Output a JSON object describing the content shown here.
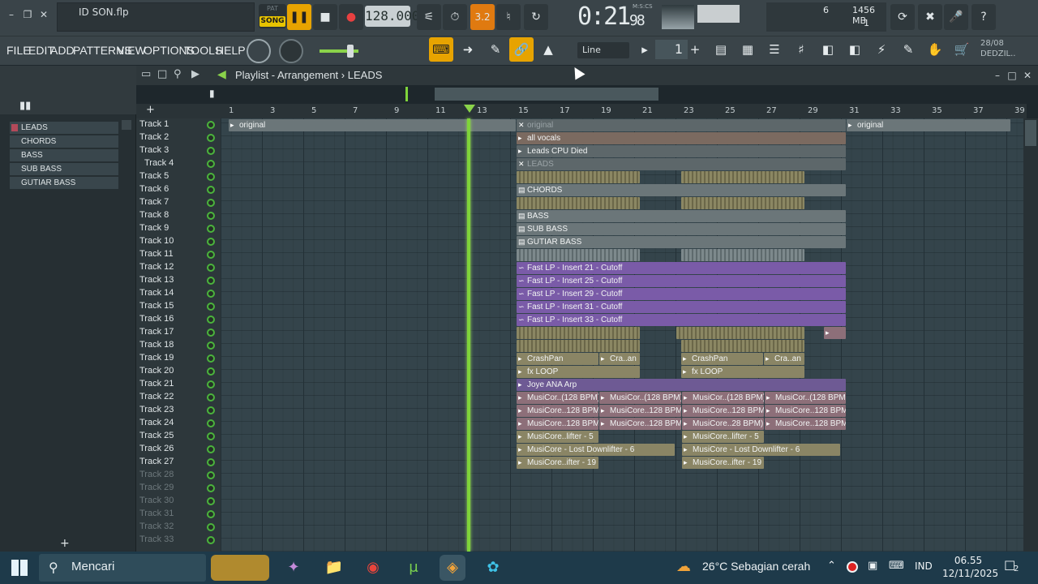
{
  "window": {
    "filename": "ID SON.flp",
    "controls": [
      "minimize",
      "restore",
      "close"
    ]
  },
  "transport": {
    "pat_label": "PAT",
    "song_label": "SONG",
    "tempo": "128.000",
    "time_main": "0:21",
    "time_frac": "98",
    "time_unit": "M:S:CS",
    "pattern_time_badge": "3.2",
    "cpu_count": "6",
    "memory": "1456 MB",
    "polyphony": "1"
  },
  "menu": {
    "items": [
      "FILE",
      "EDIT",
      "ADD",
      "PATTERNS",
      "VIEW",
      "OPTIONS",
      "TOOLS",
      "HELP"
    ]
  },
  "toolbar": {
    "snap_value": "Line",
    "pattern_number": "1",
    "date_top": "28/08",
    "date_bottom": "DEDZIL.."
  },
  "browser": {
    "items": [
      "LEADS",
      "CHORDS",
      "BASS",
      "SUB BASS",
      "GUTIAR BASS"
    ],
    "accent": "#b34a5a"
  },
  "playlist": {
    "title": "Playlist - Arrangement",
    "pattern": "LEADS",
    "bars": [
      "1",
      "3",
      "5",
      "7",
      "9",
      "11",
      "13",
      "15",
      "17",
      "19",
      "21",
      "23",
      "25",
      "27",
      "29",
      "31",
      "33",
      "35",
      "37",
      "39"
    ],
    "tracks": [
      "Track 1",
      "Track 2",
      "Track 3",
      "Track 4",
      "Track 5",
      "Track 6",
      "Track 7",
      "Track 8",
      "Track 9",
      "Track 10",
      "Track 11",
      "Track 12",
      "Track 13",
      "Track 14",
      "Track 15",
      "Track 16",
      "Track 17",
      "Track 18",
      "Track 19",
      "Track 20",
      "Track 21",
      "Track 22",
      "Track 23",
      "Track 24",
      "Track 25",
      "Track 26",
      "Track 27",
      "Track 28",
      "Track 29",
      "Track 30",
      "Track 31",
      "Track 32",
      "Track 33"
    ],
    "playhead_color": "#7fd43a",
    "clips": {
      "original_a": "original",
      "original_b": "original",
      "original_c": "original",
      "all_vocals": "all vocals",
      "leads_cpu": "Leads CPU Died",
      "leads": "LEADS",
      "chords": "CHORDS",
      "bass": "BASS",
      "sub_bass": "SUB BASS",
      "gutiar_bass": "GUTIAR BASS",
      "auto1": "Fast LP - Insert 21 - Cutoff",
      "auto2": "Fast LP - Insert 25 - Cutoff",
      "auto3": "Fast LP - Insert 29 - Cutoff",
      "auto4": "Fast LP - Insert 31 - Cutoff",
      "auto5": "Fast LP - Insert 33 - Cutoff",
      "crashpan_a": "CrashPan",
      "cra_an_a": "Cra..an",
      "crashpan_b": "CrashPan",
      "cra_an_b": "Cra..an",
      "fxloop_a": "fx LOOP",
      "fxloop_b": "fx LOOP",
      "joye": "Joye ANA Arp",
      "mc22_1": "MusiCor..(128 BPM)",
      "mc22_2": "MusiCor..(128 BPM)",
      "mc22_3": "MusiCor..(128 BPM)",
      "mc22_4": "MusiCor..(128 BPM)",
      "mc23_1": "MusiCore..128 BPM)",
      "mc23_2": "MusiCore..128 BPM)",
      "mc23_3": "MusiCore..128 BPM)",
      "mc23_4": "MusiCore..128 BPM)",
      "mc24_1": "MusiCore..128 BPM)",
      "mc24_2": "MusiCore..128 BPM)",
      "mc24_3": "MusiCore..28 BPM)",
      "mc24_4": "MusiCore..128 BPM)",
      "mc25_1": "MusiCore..lifter - 5",
      "mc25_2": "MusiCore..lifter - 5",
      "mc26_1": "MusiCore - Lost Downlifter - 6",
      "mc26_2": "MusiCore - Lost Downlifter - 6",
      "mc27_1": "MusiCore..ifter - 19",
      "mc27_2": "MusiCore..ifter - 19"
    }
  },
  "taskbar": {
    "search_placeholder": "Mencari",
    "weather": "26°C  Sebagian cerah",
    "language": "IND",
    "time": "06.55",
    "date": "12/11/2025",
    "notifications": "2"
  }
}
